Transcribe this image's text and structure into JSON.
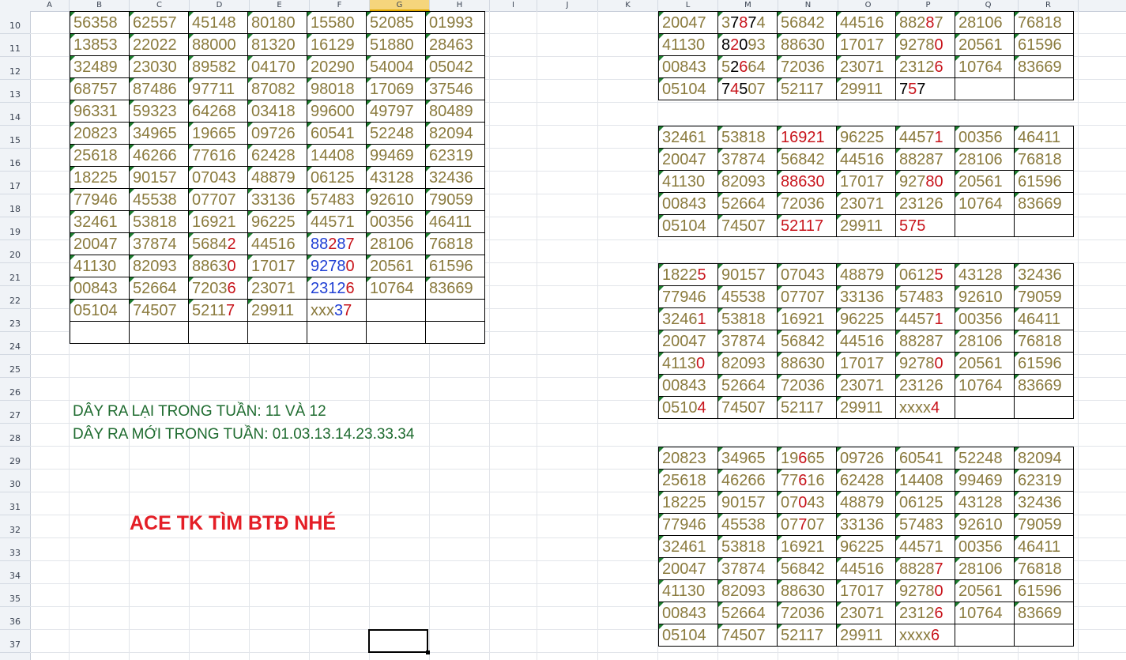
{
  "columns": [
    "A",
    "B",
    "C",
    "D",
    "E",
    "F",
    "G",
    "H",
    "I",
    "J",
    "K",
    "L",
    "M",
    "N",
    "O",
    "P",
    "Q",
    "R"
  ],
  "selected_column": "G",
  "rows": [
    "10",
    "11",
    "12",
    "13",
    "14",
    "15",
    "16",
    "17",
    "18",
    "19",
    "20",
    "21",
    "22",
    "23",
    "24",
    "25",
    "26",
    "27",
    "28",
    "29",
    "30",
    "31",
    "32",
    "33",
    "34",
    "35",
    "36",
    "37"
  ],
  "notes": {
    "line1": "DÂY RA LẠI TRONG TUẦN: 11 VÀ 12",
    "line2": "DÂY RA MỚI TRONG TUẦN: 01.03.13.14.23.33.34",
    "ace": "ACE TK TÌM BTĐ NHÉ"
  },
  "colors": {
    "number": "#8a7a3d",
    "highlight_red": "#c8141b",
    "highlight_blue": "#1f3fd4",
    "note_green": "#1e6b2f",
    "ace_red": "#e41e26"
  },
  "blocks": {
    "left": [
      [
        "56358",
        "62557",
        "45148",
        "80180",
        "15580",
        "52085",
        "01993"
      ],
      [
        "13853",
        "22022",
        "88000",
        "81320",
        "16129",
        "51880",
        "28463"
      ],
      [
        "32489",
        "23030",
        "89582",
        "04170",
        "20290",
        "54004",
        "05042"
      ],
      [
        "68757",
        "87486",
        "97711",
        "87082",
        "98018",
        "17069",
        "37546"
      ],
      [
        "96331",
        "59323",
        "64268",
        "03418",
        "99600",
        "49797",
        "80489"
      ],
      [
        "20823",
        "34965",
        "19665",
        "09726",
        "60541",
        "52248",
        "82094"
      ],
      [
        "25618",
        "46266",
        "77616",
        "62428",
        "14408",
        "99469",
        "62319"
      ],
      [
        "18225",
        "90157",
        "07043",
        "48879",
        "06125",
        "43128",
        "32436"
      ],
      [
        "77946",
        "45538",
        "07707",
        "33136",
        "57483",
        "92610",
        "79059"
      ],
      [
        "32461",
        "53818",
        "16921",
        "96225",
        "44571",
        "00356",
        "46411"
      ],
      [
        "20047",
        "37874",
        "5684|2",
        "44516",
        "8|8|2|8|7",
        "28106",
        "76818"
      ],
      [
        "41130",
        "82093",
        "8863|0",
        "17017",
        "9|2|7|8|0",
        "20561",
        "61596"
      ],
      [
        "00843",
        "52664",
        "7203|6",
        "23071",
        "2|3|1|2|6",
        "10764",
        "83669"
      ],
      [
        "05104",
        "74507",
        "5211|7",
        "29911",
        "xxx|3|7",
        "",
        ""
      ],
      [
        "",
        "",
        "",
        "",
        "",
        "",
        ""
      ]
    ],
    "r1": [
      [
        "20047",
        "3|7|8|74",
        "56842",
        "44516",
        "882|8|7",
        "28106",
        "76818"
      ],
      [
        "41130",
        "|8|2|0|93",
        "88630",
        "17017",
        "9278|0",
        "20561",
        "61596"
      ],
      [
        "00843",
        "5|2|6|64",
        "72036",
        "23071",
        "2312|6",
        "10764",
        "83669"
      ],
      [
        "05104",
        "|7|4|5|07",
        "52117",
        "29911",
        "|7|5|7",
        "",
        ""
      ]
    ],
    "r2": [
      [
        "32461",
        "53818",
        "|16921",
        "96225",
        "4457|1",
        "00356",
        "46411"
      ],
      [
        "20047",
        "37874",
        "56842",
        "44516",
        "88287",
        "28106",
        "76818"
      ],
      [
        "41130",
        "82093",
        "|886|3|0",
        "17017",
        "927|80",
        "20561",
        "61596"
      ],
      [
        "00843",
        "52664",
        "72036",
        "23071",
        "23126",
        "10764",
        "83669"
      ],
      [
        "05104",
        "74507",
        "|5211|7",
        "29911",
        "|575",
        "",
        ""
      ]
    ],
    "r3": [
      [
        "1822|5",
        "90157",
        "07043",
        "48879",
        "0612|5",
        "43128",
        "32436"
      ],
      [
        "77946",
        "45538",
        "07707",
        "33136",
        "57483",
        "92610",
        "79059"
      ],
      [
        "3246|1",
        "53818",
        "16921",
        "96225",
        "4457|1",
        "00356",
        "46411"
      ],
      [
        "20047",
        "37874",
        "56842",
        "44516",
        "88287",
        "28106",
        "76818"
      ],
      [
        "4113|0",
        "82093",
        "88630",
        "17017",
        "9278|0",
        "20561",
        "61596"
      ],
      [
        "00843",
        "52664",
        "72036",
        "23071",
        "23126",
        "10764",
        "83669"
      ],
      [
        "0510|4",
        "74507",
        "52117",
        "29911",
        "xxxx|4",
        "",
        ""
      ]
    ],
    "r4": [
      [
        "20823",
        "34965",
        "19|6|65",
        "09726",
        "60541",
        "52248",
        "82094"
      ],
      [
        "25618",
        "46266",
        "77|6|16",
        "62428",
        "14408",
        "99469",
        "62319"
      ],
      [
        "18225",
        "90157",
        "07|0|43",
        "48879",
        "06125",
        "43128",
        "32436"
      ],
      [
        "77946",
        "45538",
        "07|7|07",
        "33136",
        "57483",
        "92610",
        "79059"
      ],
      [
        "32461",
        "53818",
        "16921",
        "96225",
        "44571",
        "00356",
        "46411"
      ],
      [
        "20047",
        "37874",
        "56842",
        "44516",
        "8828|7",
        "28106",
        "76818"
      ],
      [
        "41130",
        "82093",
        "88630",
        "17017",
        "9278|0",
        "20561",
        "61596"
      ],
      [
        "00843",
        "52664",
        "72036",
        "23071",
        "2312|6",
        "10764",
        "83669"
      ],
      [
        "05104",
        "74507",
        "52117",
        "29911",
        "xxxx|6",
        "",
        ""
      ]
    ]
  }
}
